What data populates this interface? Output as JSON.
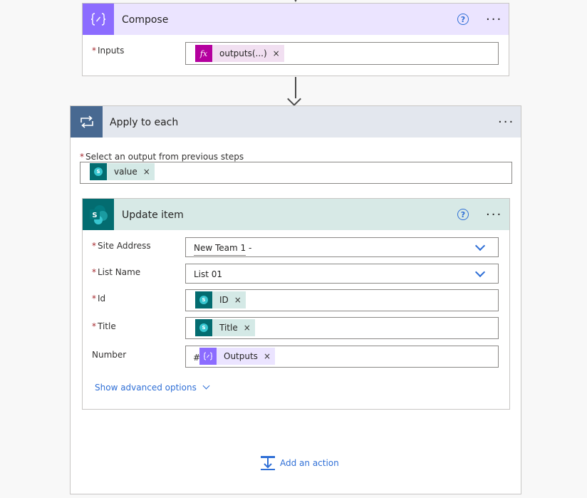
{
  "compose": {
    "title": "Compose",
    "help_glyph": "?",
    "more_glyph": "···",
    "inputs_label": "Inputs",
    "inputs_token": {
      "label": "outputs(...)",
      "icon": "fx",
      "remove": "×"
    }
  },
  "apply_to_each": {
    "title": "Apply to each",
    "more_glyph": "···",
    "select_label": "Select an output from previous steps",
    "select_token": {
      "label": "value",
      "remove": "×"
    },
    "add_action_label": "Add an action"
  },
  "update_item": {
    "title": "Update item",
    "help_glyph": "?",
    "more_glyph": "···",
    "fields": {
      "site_address": {
        "label": "Site Address",
        "value": "New Team 1 -"
      },
      "list_name": {
        "label": "List Name",
        "value": "List 01"
      },
      "id": {
        "label": "Id",
        "token": "ID",
        "remove": "×"
      },
      "title": {
        "label": "Title",
        "token": "Title",
        "remove": "×"
      },
      "number": {
        "label": "Number",
        "prefix": "#",
        "token": "Outputs",
        "remove": "×"
      }
    },
    "advanced_label": "Show advanced options"
  },
  "required_marker": "*",
  "colors": {
    "compose_accent": "#8c6cff",
    "compose_header": "#ebe4ff",
    "apply_accent": "#486991",
    "apply_header": "#e3e7ee",
    "sharepoint_accent": "#036c70",
    "sharepoint_header": "#d7e9e6",
    "expression_accent": "#b4009e",
    "link": "#2f6fd6",
    "required": "#a4262c"
  },
  "icons": {
    "compose": "compose-braces-icon",
    "apply": "loop-icon",
    "sharepoint": "sharepoint-icon",
    "help": "help-circle-icon",
    "more": "more-dots-icon",
    "chevron": "chevron-down-icon",
    "add_action": "add-action-icon"
  }
}
